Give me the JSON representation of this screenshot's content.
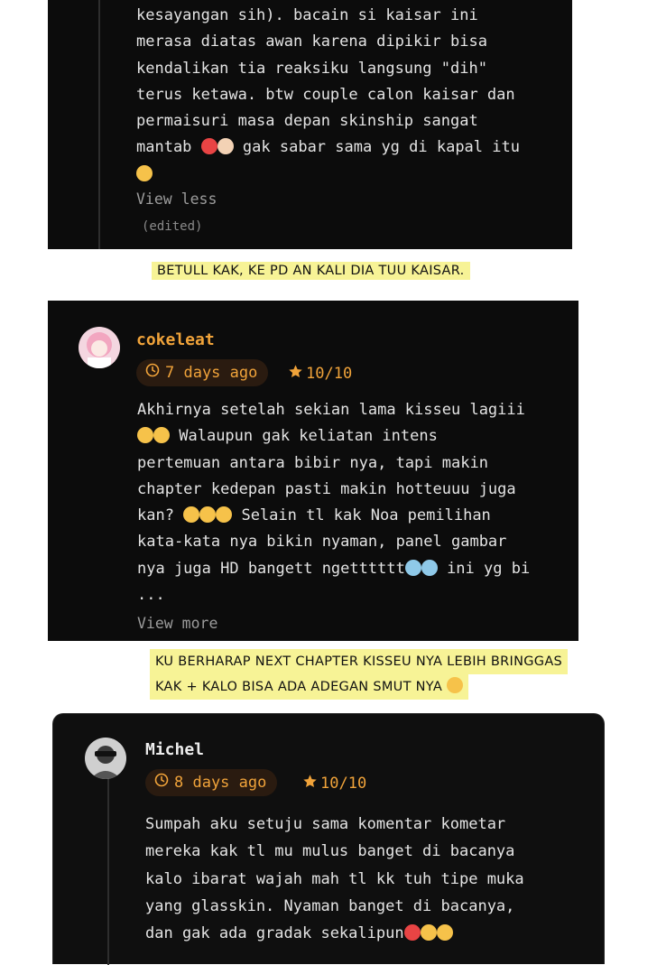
{
  "comment1": {
    "lines": [
      "kesayangan sih). bacain si kaisar ini",
      "merasa diatas awan karena dipikir bisa",
      "kendalikan tia reaksiku langsung \"dih\"",
      "terus ketawa. btw couple calon kaisar dan",
      "permaisuri masa depan skinship sangat",
      "mantab",
      "gak sabar sama yg di kapal itu"
    ],
    "view_toggle": "View less",
    "edited": "(edited)"
  },
  "note1": "BETULL KAK, KE PD AN KALI DIA TUU KAISAR.",
  "comment2": {
    "username": "cokeleat",
    "time": "7 days ago",
    "rating": "10/10",
    "lines": [
      "Akhirnya setelah sekian lama kisseu lagiii",
      "Walaupun gak keliatan intens",
      "pertemuan antara bibir nya, tapi makin",
      "chapter kedepan pasti makin hotteuuu juga",
      "kan?",
      "Selain tl kak Noa pemilihan",
      "kata-kata nya bikin nyaman, panel gambar",
      "nya juga HD bangett ngetttttt",
      "ini yg bi",
      "..."
    ],
    "view_toggle": "View more"
  },
  "note2": {
    "line1": "KU BERHARAP NEXT CHAPTER KISSEU NYA LEBIH BRINGGAS",
    "line2": "KAK + KALO BISA ADA ADEGAN SMUT NYA"
  },
  "comment3": {
    "username": "Michel",
    "time": "8 days ago",
    "rating": "10/10",
    "lines": [
      "Sumpah aku setuju sama komentar kometar",
      "mereka kak tl mu mulus banget di bacanya",
      "kalo ibarat wajah mah tl kk tuh tipe muka",
      "yang glasskin. Nyaman banget di bacanya,",
      "dan gak ada gradak sekalipun"
    ]
  },
  "colors": {
    "card_bg": "#0c0c0c",
    "accent_orange": "#f0a33a",
    "pill_bg": "#2a1b10",
    "highlight": "#f7f396",
    "username_orange": "#f0a33a"
  },
  "icons": [
    "clock-icon",
    "star-icon",
    "heart-eyes-emoji",
    "thumbs-up-emoji",
    "grin-emoji",
    "yum-emoji",
    "tongue-emoji",
    "crying-emoji",
    "laughing-emoji",
    "hundred-emoji",
    "ok-hand-emoji",
    "kissing-emoji"
  ]
}
